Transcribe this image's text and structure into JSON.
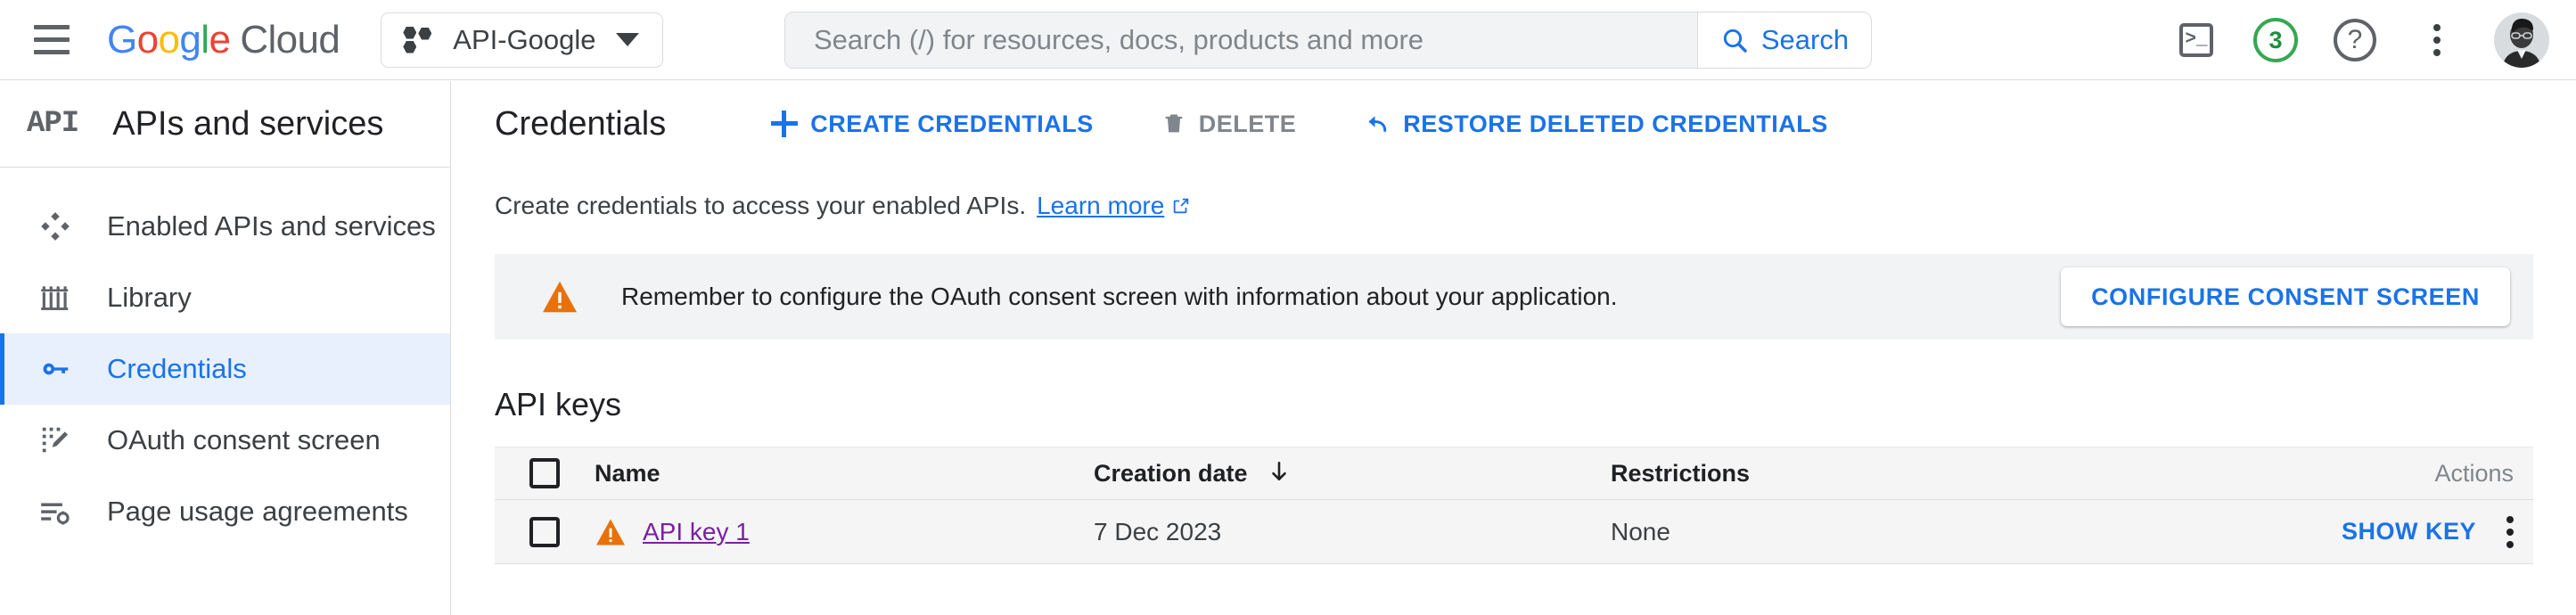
{
  "header": {
    "menu_icon": "hamburger-menu-icon",
    "brand": {
      "google": "Google",
      "cloud": "Cloud"
    },
    "project": {
      "name": "API-Google",
      "icon": "project-hexagon-icon",
      "caret": "chevron-down-icon"
    },
    "search": {
      "placeholder": "Search (/) for resources, docs, products and more",
      "value": "",
      "button_label": "Search",
      "button_icon": "search-icon"
    },
    "actions": {
      "cloud_shell": {
        "icon": "cloud-shell-terminal-icon",
        "glyph": ">_"
      },
      "notifications": {
        "icon": "notifications-badge-icon",
        "count": "3",
        "color": "#34A853"
      },
      "help": {
        "icon": "help-question-icon",
        "glyph": "?"
      },
      "more": {
        "icon": "more-vertical-kebab-icon"
      },
      "avatar": {
        "icon": "user-avatar-icon"
      }
    }
  },
  "sidebar": {
    "logo_text": "API",
    "title": "APIs and services",
    "items": [
      {
        "label": "Enabled APIs and services",
        "icon": "enabled-apis-diamond-icon",
        "active": false
      },
      {
        "label": "Library",
        "icon": "library-columns-icon",
        "active": false
      },
      {
        "label": "Credentials",
        "icon": "key-icon",
        "active": true
      },
      {
        "label": "OAuth consent screen",
        "icon": "oauth-consent-icon",
        "active": false
      },
      {
        "label": "Page usage agreements",
        "icon": "page-usage-agreements-icon",
        "active": false
      }
    ]
  },
  "main": {
    "page_title": "Credentials",
    "toolbar": [
      {
        "label": "CREATE CREDENTIALS",
        "icon": "plus-icon",
        "enabled": true
      },
      {
        "label": "DELETE",
        "icon": "trash-icon",
        "enabled": false
      },
      {
        "label": "RESTORE DELETED CREDENTIALS",
        "icon": "undo-arrow-icon",
        "enabled": true
      }
    ],
    "description": {
      "text": "Create credentials to access your enabled APIs.",
      "link_label": "Learn more",
      "link_icon": "external-link-icon"
    },
    "banner": {
      "icon": "warning-triangle-icon",
      "icon_color": "#E8710A",
      "message": "Remember to configure the OAuth consent screen with information about your application.",
      "button_label": "CONFIGURE CONSENT SCREEN"
    },
    "section_title": "API keys",
    "table": {
      "columns": [
        "Name",
        "Creation date",
        "Restrictions",
        "Actions"
      ],
      "sort_column": "Creation date",
      "sort_icon": "arrow-down-icon",
      "rows": [
        {
          "name": "API key 1",
          "name_icon": "warning-triangle-icon",
          "creation_date": "7 Dec 2023",
          "restrictions": "None",
          "action_label": "SHOW KEY",
          "row_menu_icon": "more-vertical-kebab-icon"
        }
      ]
    }
  },
  "colors": {
    "accent_blue": "#1a73e8",
    "link_visited_purple": "#7b1fa2",
    "warning_orange": "#E8710A",
    "green": "#34A853",
    "active_nav_bg": "#e8f0fe",
    "table_row_bg": "#f5f5f5"
  }
}
